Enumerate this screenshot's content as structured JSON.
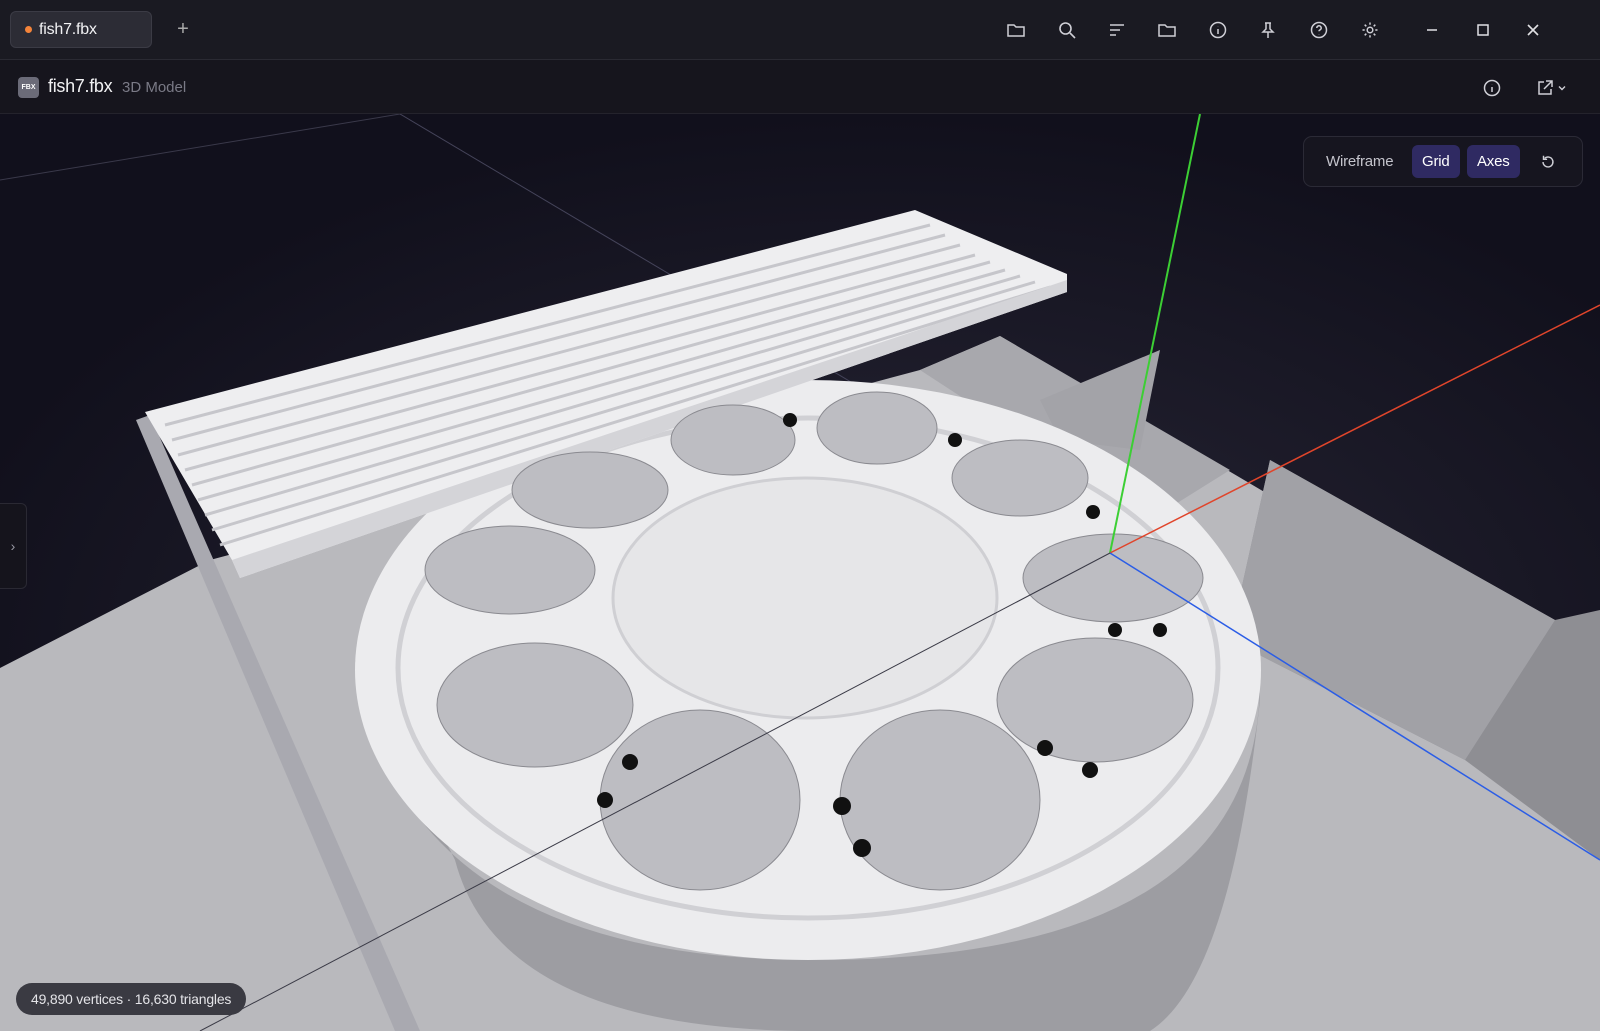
{
  "tab": {
    "label": "fish7.fbx",
    "dot_color": "#f5843a",
    "new_tab_label": "+"
  },
  "titlebar_icons": [
    "open-folder-icon",
    "search-icon",
    "sort-icon",
    "folder-icon",
    "info-icon",
    "pin-icon",
    "help-icon",
    "gear-icon"
  ],
  "window_controls": [
    "minimize-icon",
    "maximize-icon",
    "close-icon"
  ],
  "file": {
    "badge": "FBX",
    "name": "fish7.fbx",
    "type": "3D Model"
  },
  "subbar_icons": [
    "info-icon",
    "export-icon",
    "chevron-down-icon"
  ],
  "viewer_toolbar": {
    "wireframe": {
      "label": "Wireframe",
      "active": false
    },
    "grid": {
      "label": "Grid",
      "active": true
    },
    "axes": {
      "label": "Axes",
      "active": true
    },
    "reset_icon": "reset-view-icon"
  },
  "side_panel_toggle": "›",
  "stats": "49,890 vertices · 16,630 triangles",
  "colors": {
    "accent": "#2f2a62",
    "axis_x": "#e0452b",
    "axis_y": "#3ccf34",
    "axis_z": "#2b5de6"
  }
}
